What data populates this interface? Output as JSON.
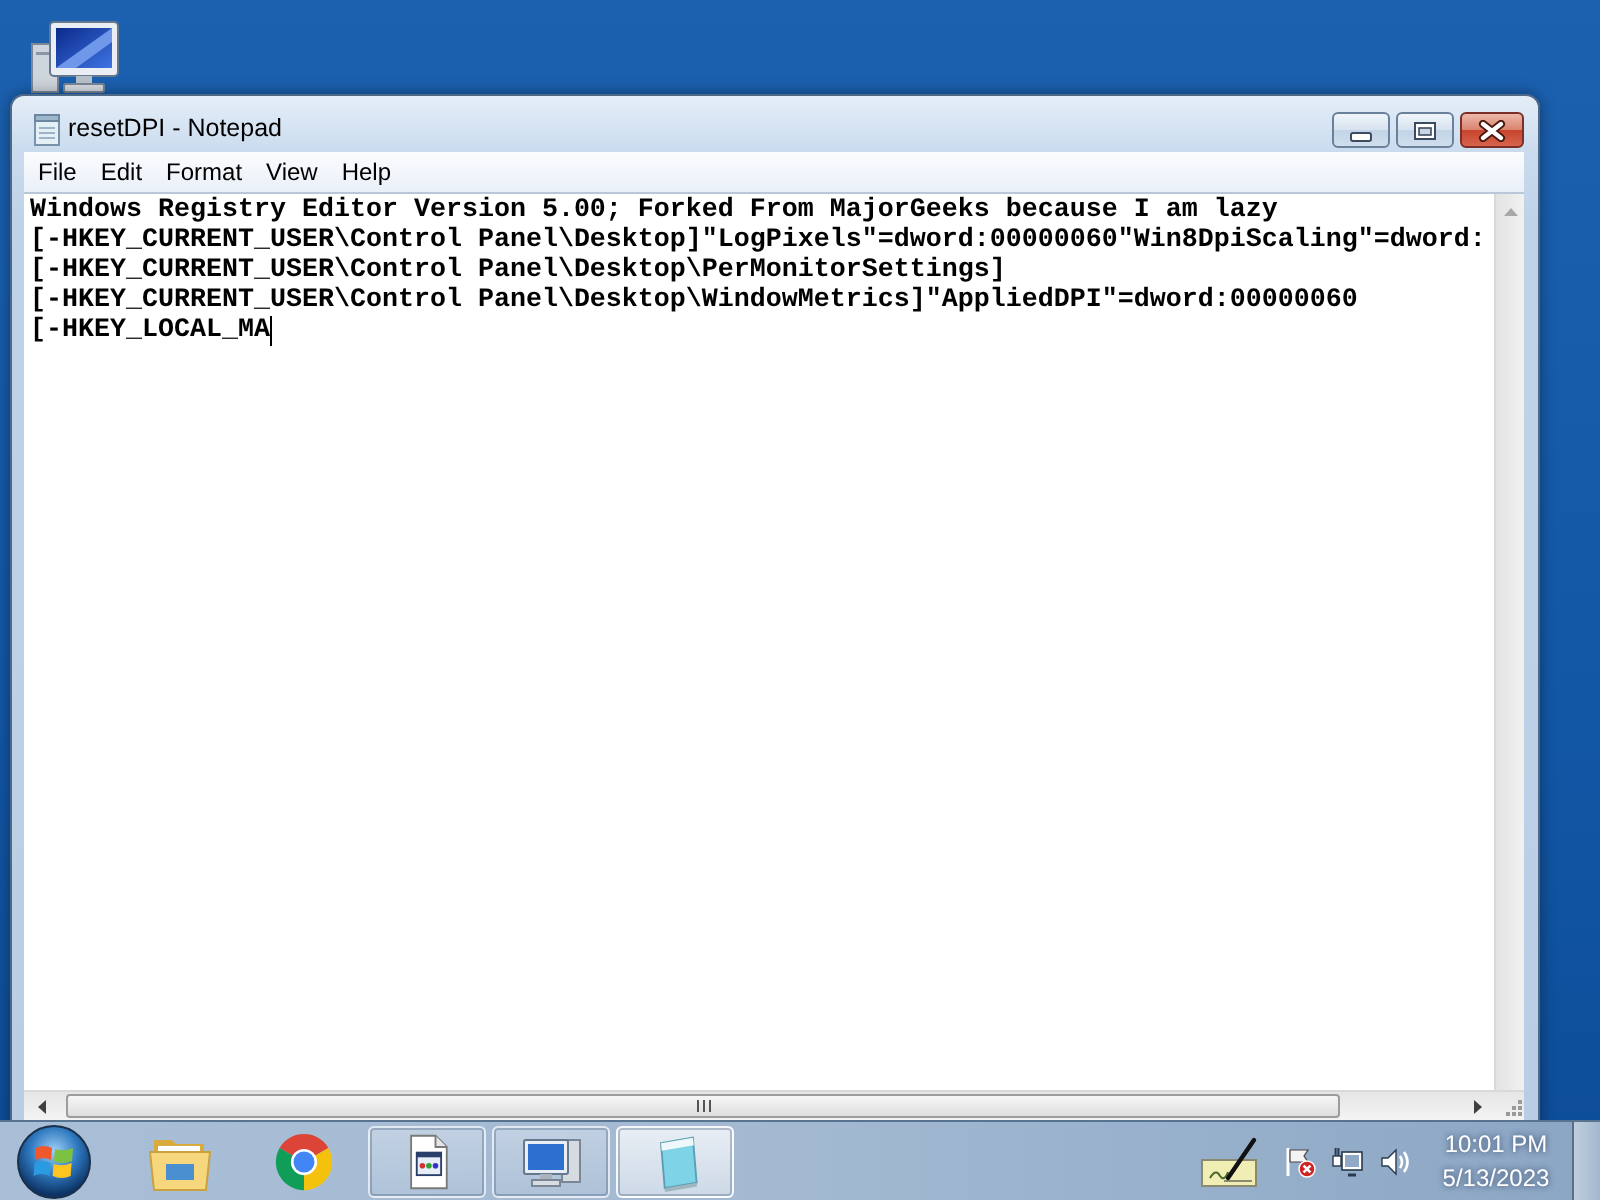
{
  "window": {
    "title": "resetDPI - Notepad"
  },
  "menu": [
    "File",
    "Edit",
    "Format",
    "View",
    "Help"
  ],
  "editor": {
    "lines": [
      {
        "text": "Windows Registry Editor Version 5.00; Forked From MajorGeeks because I am lazy",
        "caret": false
      },
      {
        "text": "[-HKEY_CURRENT_USER\\Control Panel\\Desktop]\"LogPixels\"=dword:00000060\"Win8DpiScaling\"=dword:",
        "caret": false
      },
      {
        "text": "[-HKEY_CURRENT_USER\\Control Panel\\Desktop\\PerMonitorSettings]",
        "caret": false
      },
      {
        "text": "[-HKEY_CURRENT_USER\\Control Panel\\Desktop\\WindowMetrics]\"AppliedDPI\"=dword:00000060",
        "caret": false
      },
      {
        "text": "[-HKEY_LOCAL_MA",
        "caret": true
      }
    ]
  },
  "taskbar": {
    "items": [
      {
        "kind": "pinned",
        "selected": false
      },
      {
        "kind": "pinned",
        "selected": false
      },
      {
        "kind": "window",
        "selected": false
      },
      {
        "kind": "window",
        "selected": false
      },
      {
        "kind": "window",
        "selected": true
      }
    ]
  },
  "clock": {
    "time": "10:01 PM",
    "date": "5/13/2023"
  }
}
